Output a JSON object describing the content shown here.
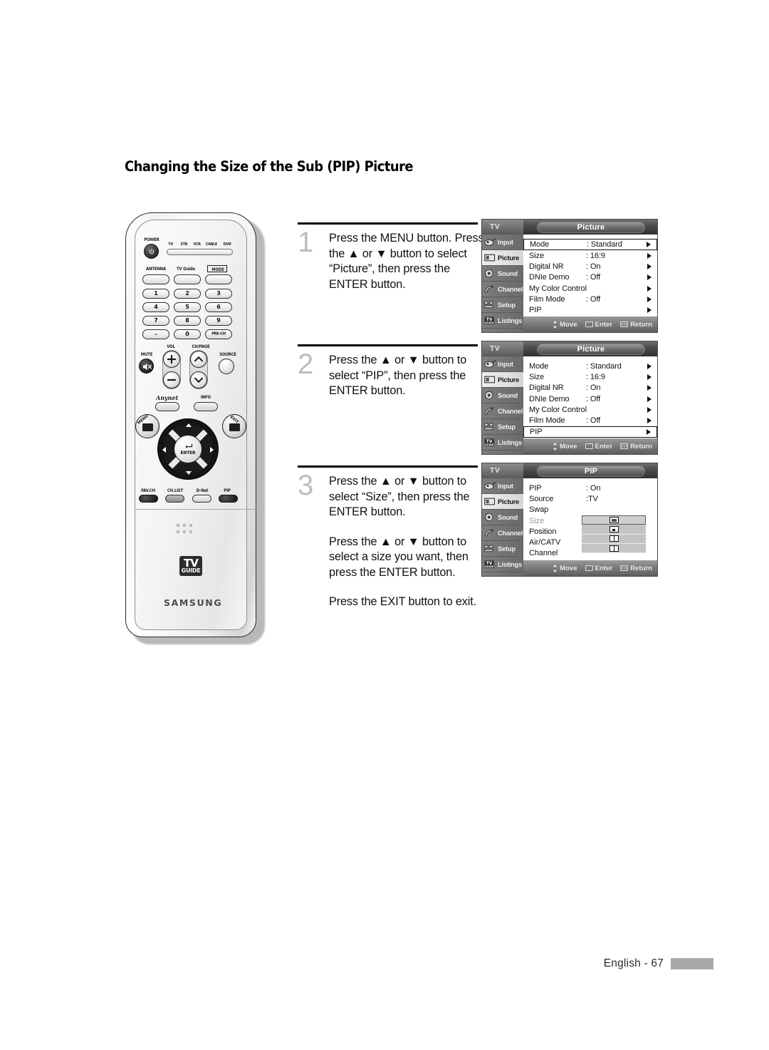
{
  "page": {
    "title": "Changing the Size of the Sub (PIP) Picture",
    "footer_text": "English - 67"
  },
  "remote": {
    "power_label": "POWER",
    "device_labels": [
      "TV",
      "STB",
      "VCR",
      "CABLE",
      "DVD"
    ],
    "row_labels": [
      "ANTENNA",
      "TV Guide",
      "MODE"
    ],
    "keypad": [
      "1",
      "2",
      "3",
      "4",
      "5",
      "6",
      "7",
      "8",
      "9",
      "–",
      "0",
      "PRE-CH"
    ],
    "vol_label": "VOL",
    "ch_label": "CH/PAGE",
    "mute_label": "MUTE",
    "source_label": "SOURCE",
    "anynet_label": "Anynet",
    "info_label": "INFO",
    "menu_label": "MENU",
    "exit_label": "EXIT",
    "enter_label": "ENTER",
    "bottom_buttons": [
      "FAV.CH",
      "CH.LIST",
      "D-Net",
      "PIP"
    ],
    "tvguide_top": "TV",
    "tvguide_bottom": "GUIDE",
    "brand": "SAMSUNG"
  },
  "steps": [
    {
      "number": "1",
      "lines": [
        "Press the MENU button. Press the ▲ or ▼ button to select “Picture”, then press the ENTER button."
      ]
    },
    {
      "number": "2",
      "lines": [
        "Press the ▲ or ▼ button to select “PIP”, then press the ENTER button."
      ]
    },
    {
      "number": "3",
      "lines": [
        "Press the ▲ or ▼ button to select “Size”, then press the ENTER button.",
        "Press the ▲ or ▼ button to select a size you want, then press the ENTER button.",
        "Press the EXIT button to exit."
      ]
    }
  ],
  "osd_common": {
    "source_label": "TV",
    "sidebar": [
      {
        "label": "Input",
        "icon": "input-icon",
        "active": false
      },
      {
        "label": "Picture",
        "icon": "picture-icon",
        "active": true
      },
      {
        "label": "Sound",
        "icon": "sound-icon",
        "active": false
      },
      {
        "label": "Channel",
        "icon": "channel-icon",
        "active": false
      },
      {
        "label": "Setup",
        "icon": "setup-icon",
        "active": false
      },
      {
        "label": "Listings",
        "icon": "listings-icon",
        "active": false
      }
    ],
    "status": [
      {
        "label": "Move",
        "icon": "updown-arrows-icon"
      },
      {
        "label": "Enter",
        "icon": "enter-key-icon"
      },
      {
        "label": "Return",
        "icon": "return-key-icon"
      }
    ]
  },
  "osd_panels": [
    {
      "title": "Picture",
      "rows": [
        {
          "name": "Mode",
          "value": ": Standard",
          "arrow": true,
          "boxed": true,
          "dim": false
        },
        {
          "name": "Size",
          "value": ": 16:9",
          "arrow": true,
          "boxed": false,
          "dim": false
        },
        {
          "name": "Digital NR",
          "value": ": On",
          "arrow": true,
          "boxed": false,
          "dim": false
        },
        {
          "name": "DNIe Demo",
          "value": ": Off",
          "arrow": true,
          "boxed": false,
          "dim": false
        },
        {
          "name": "My Color Control",
          "value": "",
          "arrow": true,
          "boxed": false,
          "dim": false
        },
        {
          "name": "Film Mode",
          "value": ": Off",
          "arrow": true,
          "boxed": false,
          "dim": false
        },
        {
          "name": "PIP",
          "value": "",
          "arrow": true,
          "boxed": false,
          "dim": false
        }
      ]
    },
    {
      "title": "Picture",
      "rows": [
        {
          "name": "Mode",
          "value": ": Standard",
          "arrow": true,
          "boxed": false,
          "dim": false
        },
        {
          "name": "Size",
          "value": ": 16:9",
          "arrow": true,
          "boxed": false,
          "dim": false
        },
        {
          "name": "Digital NR",
          "value": ": On",
          "arrow": true,
          "boxed": false,
          "dim": false
        },
        {
          "name": "DNIe Demo",
          "value": ": Off",
          "arrow": true,
          "boxed": false,
          "dim": false
        },
        {
          "name": "My Color Control",
          "value": "",
          "arrow": true,
          "boxed": false,
          "dim": false
        },
        {
          "name": "Film Mode",
          "value": ": Off",
          "arrow": true,
          "boxed": false,
          "dim": false
        },
        {
          "name": "PIP",
          "value": "",
          "arrow": true,
          "boxed": true,
          "dim": false
        }
      ]
    },
    {
      "title": "PIP",
      "rows": [
        {
          "name": "PIP",
          "value": ": On",
          "arrow": false,
          "boxed": false,
          "dim": false
        },
        {
          "name": "Source",
          "value": ":TV",
          "arrow": false,
          "boxed": false,
          "dim": false
        },
        {
          "name": "Swap",
          "value": "",
          "arrow": false,
          "boxed": false,
          "dim": false
        },
        {
          "name": "Size",
          "value": "",
          "arrow": false,
          "boxed": false,
          "dim": true
        },
        {
          "name": "Position",
          "value": "",
          "arrow": false,
          "boxed": false,
          "dim": false
        },
        {
          "name": "Air/CATV",
          "value": "",
          "arrow": false,
          "boxed": false,
          "dim": false
        },
        {
          "name": "Channel",
          "value": "",
          "arrow": false,
          "boxed": false,
          "dim": false
        }
      ],
      "size_options": [
        {
          "glyph": "pip-large-icon",
          "selected": true
        },
        {
          "glyph": "pip-small-icon",
          "selected": false
        },
        {
          "glyph": "pip-dual-icon",
          "selected": false
        },
        {
          "glyph": "pip-double-icon",
          "selected": false
        }
      ]
    }
  ]
}
